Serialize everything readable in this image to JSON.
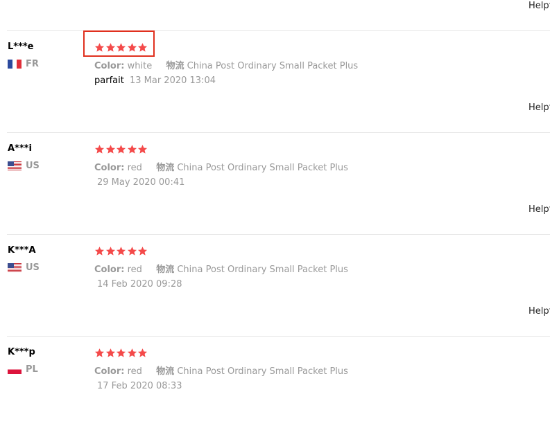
{
  "helpful_label": "Helpf",
  "reviews": [
    {
      "user": "L***e",
      "country": "FR",
      "flag": "france-flag-icon",
      "rating": 5,
      "color_label": "Color:",
      "color_value": "white",
      "logistics_label": "物流",
      "logistics_value": "China Post Ordinary Small Packet Plus",
      "text": "parfait",
      "date": "13 Mar 2020 13:04",
      "highlighted": true
    },
    {
      "user": "A***i",
      "country": "US",
      "flag": "usa-flag-icon",
      "rating": 5,
      "color_label": "Color:",
      "color_value": "red",
      "logistics_label": "物流",
      "logistics_value": "China Post Ordinary Small Packet Plus",
      "text": "",
      "date": "29 May 2020 00:41"
    },
    {
      "user": "K***A",
      "country": "US",
      "flag": "usa-flag-icon",
      "rating": 5,
      "color_label": "Color:",
      "color_value": "red",
      "logistics_label": "物流",
      "logistics_value": "China Post Ordinary Small Packet Plus",
      "text": "",
      "date": "14 Feb 2020 09:28"
    },
    {
      "user": "K***p",
      "country": "PL",
      "flag": "poland-flag-icon",
      "rating": 5,
      "color_label": "Color:",
      "color_value": "red",
      "logistics_label": "物流",
      "logistics_value": "China Post Ordinary Small Packet Plus",
      "text": "",
      "date": "17 Feb 2020 08:33"
    }
  ],
  "colors": {
    "star": "#f44a4a",
    "highlight_border": "#e0301e",
    "muted_text": "#999999",
    "divider": "#e6e6e6"
  }
}
